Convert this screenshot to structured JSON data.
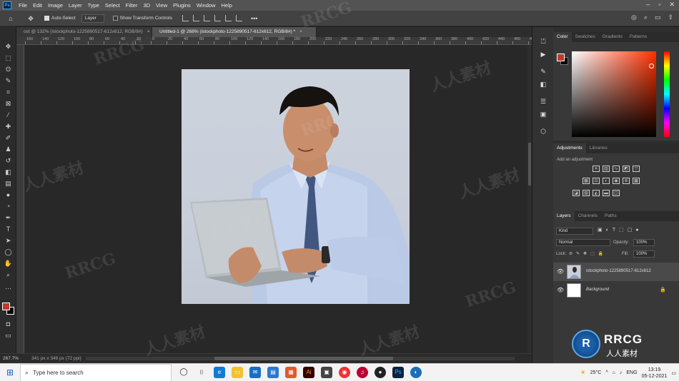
{
  "app": {
    "logo": "Ps"
  },
  "menu": [
    "File",
    "Edit",
    "Image",
    "Layer",
    "Type",
    "Select",
    "Filter",
    "3D",
    "View",
    "Plugins",
    "Window",
    "Help"
  ],
  "options": {
    "auto_select_label": "Auto-Select",
    "auto_select_value": "Layer",
    "transform_label": "Show Transform Controls",
    "more": "•••"
  },
  "tabs": [
    {
      "label": "ost @ 132% (istockphoto-1225890517-612x612, RGB/8#)",
      "active": false
    },
    {
      "label": "Untitled-1 @ 268% (istockphoto-1225890517-612x612, RGB/8#) *",
      "active": true
    }
  ],
  "ruler_ticks": [
    "160",
    "140",
    "120",
    "100",
    "80",
    "60",
    "40",
    "20",
    "0",
    "20",
    "40",
    "60",
    "80",
    "100",
    "120",
    "140",
    "160",
    "180",
    "200",
    "220",
    "240",
    "260",
    "280",
    "300",
    "320",
    "340",
    "360",
    "380",
    "400",
    "420",
    "440",
    "460",
    "480"
  ],
  "status": {
    "zoom": "267.7%",
    "doc_info": "341 px x 349 px (72 ppi)"
  },
  "color_panel": {
    "tabs": [
      "Color",
      "Swatches",
      "Gradients",
      "Patterns"
    ],
    "fg": "#c0392b",
    "bg": "#000000"
  },
  "adjustments_panel": {
    "tabs": [
      "Adjustments",
      "Libraries"
    ],
    "hint": "Add an adjustment"
  },
  "layers_panel": {
    "tabs": [
      "Layers",
      "Channels",
      "Paths"
    ],
    "filter_kind": "Kind",
    "blend_mode": "Normal",
    "opacity_label": "Opacity:",
    "opacity_value": "100%",
    "lock_label": "Lock:",
    "fill_label": "Fill:",
    "fill_value": "100%",
    "layers": [
      {
        "name": "istockphoto-1225890517-612x612",
        "selected": true
      },
      {
        "name": "Background",
        "selected": false
      }
    ]
  },
  "taskbar": {
    "search_placeholder": "Type here to search",
    "weather": "25°C",
    "language": "ENG",
    "time": "13:19",
    "date": "05-12-2021"
  },
  "watermark": {
    "text_latin": "RRCG",
    "text_cn": "人人素材"
  }
}
